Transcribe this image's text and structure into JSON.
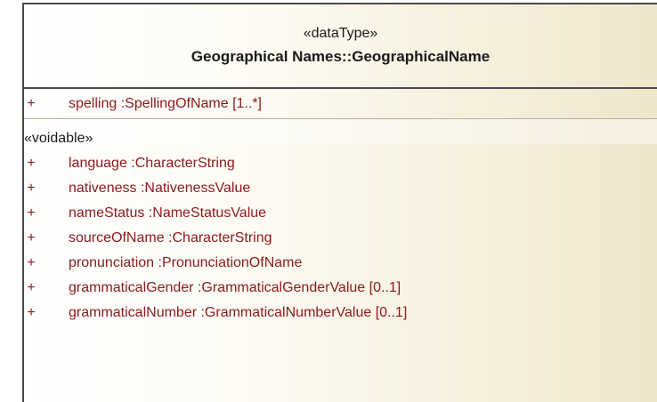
{
  "uml_class": {
    "stereotype": "«dataType»",
    "name": "Geographical Names::GeographicalName",
    "main_attributes": [
      {
        "visibility": "+",
        "text": "spelling :SpellingOfName [1..*]"
      }
    ],
    "voidable_group": {
      "label": "«voidable»",
      "attributes": [
        {
          "visibility": "+",
          "text": "language :CharacterString"
        },
        {
          "visibility": "+",
          "text": "nativeness :NativenessValue"
        },
        {
          "visibility": "+",
          "text": "nameStatus :NameStatusValue"
        },
        {
          "visibility": "+",
          "text": "sourceOfName :CharacterString"
        },
        {
          "visibility": "+",
          "text": "pronunciation :PronunciationOfName"
        },
        {
          "visibility": "+",
          "text": "grammaticalGender :GrammaticalGenderValue [0..1]"
        },
        {
          "visibility": "+",
          "text": "grammaticalNumber :GrammaticalNumberValue [0..1]"
        }
      ]
    }
  },
  "colors": {
    "attribute_text": "#8b1a1a",
    "border": "#4a4a4a",
    "fill_start": "#ffffff",
    "fill_end": "#efe6cd"
  }
}
